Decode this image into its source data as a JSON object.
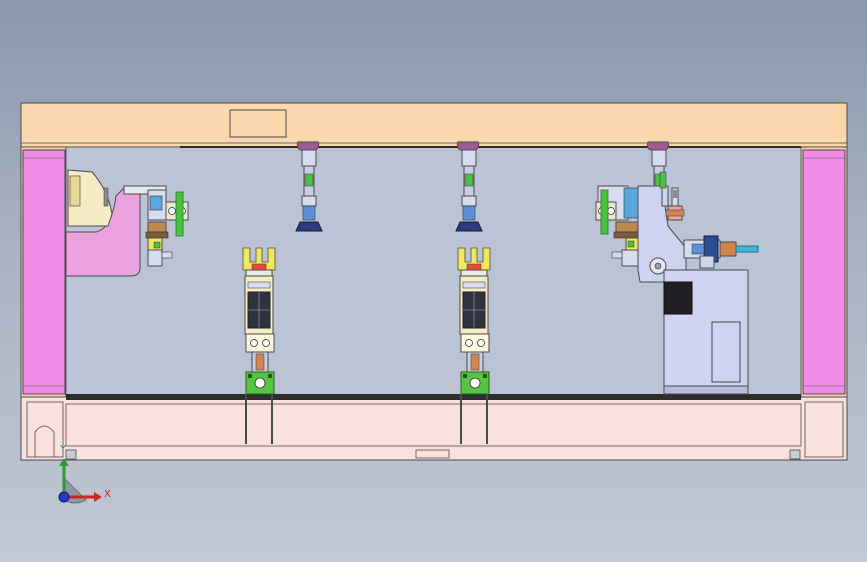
{
  "view": {
    "background_top": "#8a96ac",
    "background_bottom": "#c2c8d4"
  },
  "colors": {
    "frame_fill": "#fbd7ae",
    "frame_stroke": "#4a4a4a",
    "column_fill": "#f08ce8",
    "base_fill": "#fbe1dd",
    "interior_fill": "#bbc4d4",
    "punch_fill": "#a05a96",
    "suction_fill": "#2a3a7a",
    "module_yellow": "#f2e85c",
    "module_green": "#57c443",
    "machine_fill": "#cfd3f2",
    "pink_bracket": "#eaa3de"
  },
  "triad": {
    "x_label": "X",
    "y_label": "Y",
    "icons": [
      "axis-triad-icon"
    ]
  }
}
